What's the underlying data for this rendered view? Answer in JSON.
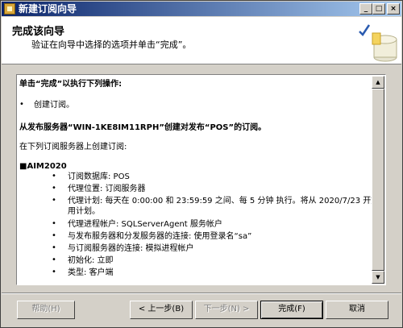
{
  "window": {
    "title": "新建订阅向导"
  },
  "header": {
    "title": "完成该向导",
    "subtitle": "验证在向导中选择的选项并单击“完成”。"
  },
  "content": {
    "intro": "单击“完成”以执行下列操作:",
    "action_item": "创建订阅。",
    "publication_line": "从发布服务器“WIN-1KE8IM11RPH”创建对发布“POS”的订阅。",
    "subscribers_heading": "在下列订阅服务器上创建订阅:",
    "subscriber_name": "■AIM2020",
    "details": [
      "订阅数据库: POS",
      "代理位置: 订阅服务器",
      "代理计划: 每天在 0:00:00 和 23:59:59 之间、每 5 分钟 执行。将从 2020/7/23 开始使",
      "用计划。",
      "代理进程帐户: SQLServerAgent 服务帐户",
      "与发布服务器和分发服务器的连接: 使用登录名“sa”",
      "与订阅服务器的连接: 模拟进程帐户",
      "初始化: 立即",
      "类型: 客户端"
    ]
  },
  "buttons": {
    "help": "帮助(H)",
    "back": "< 上一步(B)",
    "next": "下一步(N) >",
    "finish": "完成(F)",
    "cancel": "取消"
  },
  "window_controls": {
    "minimize": "_",
    "maximize": "□",
    "close": "×"
  }
}
